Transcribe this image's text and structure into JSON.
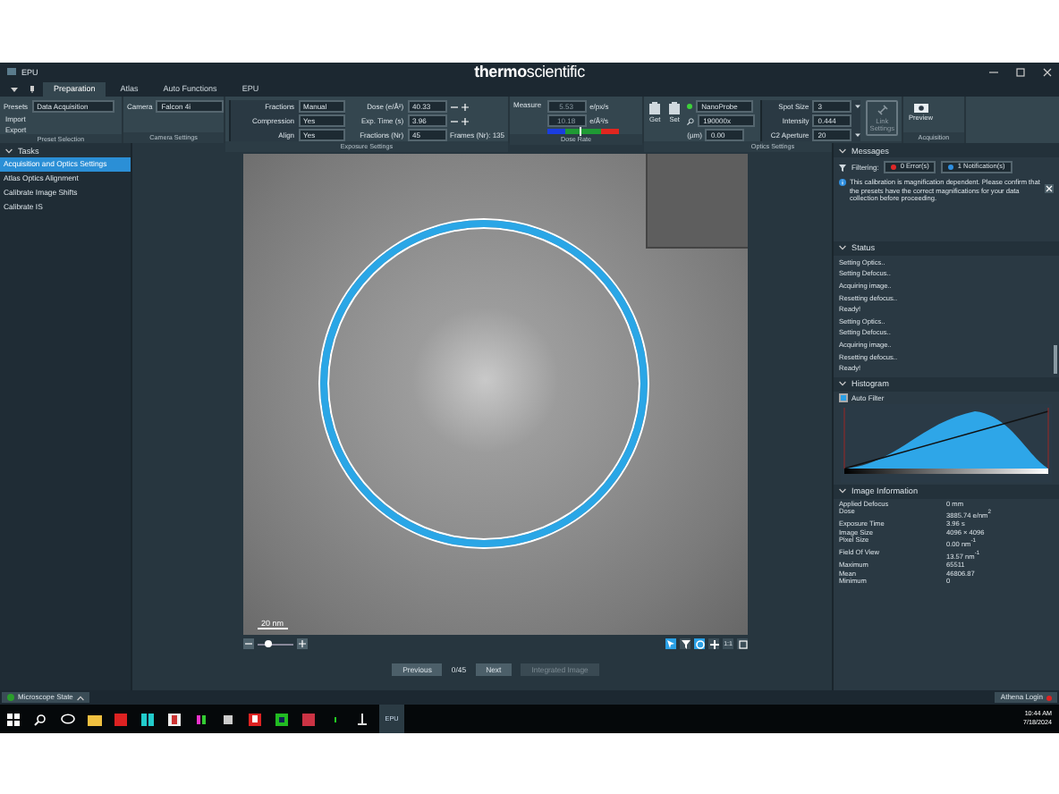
{
  "window": {
    "title": "EPU",
    "brand_left": "thermo",
    "brand_right": "scientific"
  },
  "tabs": [
    {
      "label": "Preparation",
      "selected": true
    },
    {
      "label": "Atlas",
      "selected": false
    },
    {
      "label": "Auto Functions",
      "selected": false
    },
    {
      "label": "EPU",
      "selected": false
    }
  ],
  "presets": {
    "label": "Presets",
    "value": "Data Acquisition",
    "actions": [
      "Import",
      "Export"
    ],
    "caption": "Preset Selection"
  },
  "camera": {
    "label": "Camera",
    "value": "Falcon 4i",
    "caption": "Camera Settings"
  },
  "exposure": {
    "selects": [
      {
        "label": "Fractions",
        "value": "Manual"
      },
      {
        "label": "Compression",
        "value": "Yes"
      },
      {
        "label": "Align",
        "value": "Yes"
      }
    ],
    "inputs": [
      {
        "label": "Dose (e/Å²)",
        "value": "40.33",
        "stepper": true
      },
      {
        "label": "Exp. Time (s)",
        "value": "3.96",
        "stepper": true
      },
      {
        "label": "Fractions (Nr)",
        "value": "45",
        "stepper": false
      }
    ],
    "frames": "Frames (Nr): 135",
    "caption": "Exposure Settings"
  },
  "dose_rate": {
    "label": "Measure",
    "readings": [
      {
        "value": "5.53",
        "unit": "e/px/s"
      },
      {
        "value": "10.18",
        "unit": "e/Å²/s"
      }
    ],
    "level": 0.45,
    "caption": "Dose Rate"
  },
  "optics": {
    "buttons": [
      "Get",
      "Set"
    ],
    "probe": "NanoProbe",
    "mag": "190000x",
    "defocus_label": "(µm)",
    "defocus": "0.00",
    "fields": [
      {
        "label": "Spot Size",
        "value": "3",
        "kind": "select"
      },
      {
        "label": "Intensity",
        "value": "0.444",
        "kind": "input"
      },
      {
        "label": "C2 Aperture",
        "value": "20",
        "kind": "select"
      }
    ],
    "link": {
      "label": "Link Settings",
      "disabled": true
    },
    "caption": "Optics Settings"
  },
  "acquisition": {
    "button": "Preview",
    "caption": "Acquisition"
  },
  "tasks": {
    "title": "Tasks",
    "items": [
      {
        "label": "Acquisition and Optics Settings",
        "selected": true
      },
      {
        "label": "Atlas Optics Alignment",
        "selected": false
      },
      {
        "label": "Calibrate Image Shifts",
        "selected": false
      },
      {
        "label": "Calibrate IS",
        "selected": false
      }
    ]
  },
  "viewer": {
    "scale": "20 nm",
    "zoom": {
      "level": 0.3
    },
    "tools": [
      {
        "kind": "select",
        "selected": true
      },
      {
        "kind": "filter",
        "selected": false
      },
      {
        "kind": "circle",
        "selected": true
      },
      {
        "kind": "pan",
        "selected": false
      },
      {
        "kind": "one",
        "label": "1:1",
        "selected": false
      },
      {
        "kind": "fit",
        "selected": false
      }
    ],
    "nav": [
      {
        "label": "Previous",
        "disabled": false,
        "kind": "button"
      },
      {
        "label": "0/45",
        "kind": "counter"
      },
      {
        "label": "Next",
        "disabled": false,
        "kind": "button"
      },
      {
        "label": "Integrated Image",
        "disabled": true,
        "kind": "button"
      }
    ]
  },
  "messages": {
    "title": "Messages",
    "filter_label": "Filtering:",
    "filters": [
      {
        "label": "0 Error(s)",
        "color": "#e02828"
      },
      {
        "label": "1 Notification(s)",
        "color": "#2f8fe0"
      }
    ],
    "items": [
      "This calibration is magnification dependent. Please confirm that the presets have the correct magnifications for your data collection before proceeding."
    ]
  },
  "status": {
    "title": "Status",
    "lines": [
      "Setting Optics..",
      "Setting Defocus..",
      "Acquiring image..",
      "Resetting defocus..",
      "Ready!",
      "Setting Optics..",
      "Setting Defocus..",
      "Acquiring image..",
      "Resetting defocus..",
      "Ready!"
    ]
  },
  "histogram": {
    "title": "Histogram",
    "auto_filter": {
      "label": "Auto Filter",
      "checked": true
    }
  },
  "image_info": {
    "title": "Image Information",
    "rows": [
      [
        "Applied Defocus",
        "0 mm"
      ],
      [
        "Dose",
        "3885.74 e/nm$^{2}$"
      ],
      [
        "Exposure Time",
        "3.96 s"
      ],
      [
        "Image Size",
        "4096 × 4096"
      ],
      [
        "Pixel Size",
        "0.00 nm$^{-1}$"
      ],
      [
        "Field Of View",
        "13.57 nm$^{-1}$"
      ],
      [
        "Maximum",
        "65511"
      ],
      [
        "Mean",
        "46806.87"
      ],
      [
        "Minimum",
        "0"
      ]
    ]
  },
  "footer": {
    "state": "Microscope State",
    "login": "Athena Login"
  },
  "taskbar": {
    "app": "EPU",
    "time": "10:44 AM",
    "date": "7/18/2024"
  }
}
